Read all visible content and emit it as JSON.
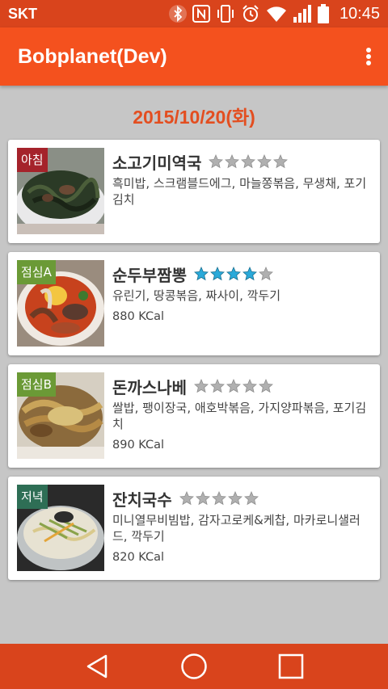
{
  "status_bar": {
    "carrier": "SKT",
    "time": "10:45",
    "icons": [
      "bluetooth-icon",
      "nfc-icon",
      "vibrate-icon",
      "alarm-icon",
      "wifi-icon",
      "signal-icon",
      "battery-icon"
    ]
  },
  "app_bar": {
    "title": "Bobplanet(Dev)",
    "menu_icon": "more-vert-icon"
  },
  "date": "2015/10/20(화)",
  "meals": [
    {
      "badge": "아침",
      "badge_color": "#a5232b",
      "name": "소고기미역국",
      "rating": 0,
      "menu": "흑미밥, 스크램블드에그, 마늘쫑볶음, 무생채, 포기김치",
      "kcal": ""
    },
    {
      "badge": "점심A",
      "badge_color": "#6b9a36",
      "name": "순두부짬뽕",
      "rating": 4,
      "menu": "유린기, 땅콩볶음, 짜사이, 깍두기",
      "kcal": "880 KCal"
    },
    {
      "badge": "점심B",
      "badge_color": "#6b9a36",
      "name": "돈까스나베",
      "rating": 0,
      "menu": "쌀밥, 팽이장국, 애호박볶음, 가지양파볶음, 포기김치",
      "kcal": "890 KCal"
    },
    {
      "badge": "저녁",
      "badge_color": "#2e6e55",
      "name": "잔치국수",
      "rating": 0,
      "menu": "미니열무비빔밥, 감자고로케&케찹, 마카로니샐러드, 깍두기",
      "kcal": "820 KCal"
    }
  ],
  "nav_bar": {
    "buttons": [
      "back-icon",
      "home-icon",
      "recents-icon"
    ]
  },
  "colors": {
    "accent": "#f4511e",
    "status_bar": "#d9441c",
    "date_text": "#e34e20",
    "star_filled": "#2aa9d9",
    "star_empty": "#b0b0b0"
  }
}
